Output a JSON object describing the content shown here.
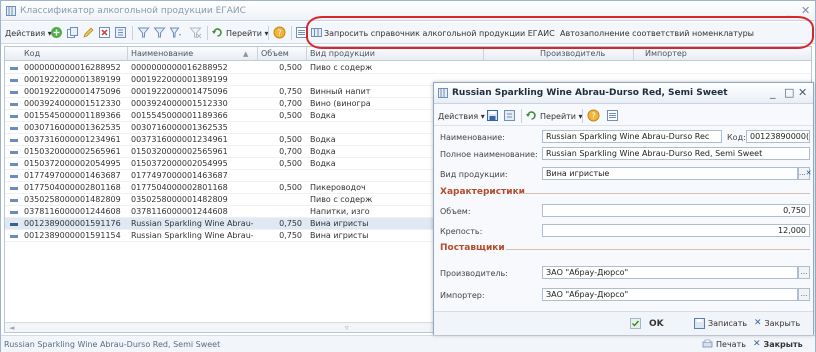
{
  "window": {
    "title": "Классификатор алкогольной продукции ЕГАИС",
    "min_glyph": "_",
    "close_glyph": "✕"
  },
  "toolbar": {
    "actions_label": "Действия ▾",
    "goto_label": "Перейти ▾",
    "request_label": "Запросить справочник алкогольной продукции ЕГАИС",
    "autofill_label": "Автозаполнение соответствий номенклатуры"
  },
  "grid": {
    "columns": [
      "Код",
      "Наименование",
      "Объем",
      "Вид продукции",
      "Производитель",
      "Импортер"
    ],
    "sort_glyph": "▲",
    "rows": [
      {
        "code": "0000000000016288952",
        "name": "0000000000016288952",
        "volume": "0,500",
        "kind": "Пиво с содерж"
      },
      {
        "code": "0001922000001389199",
        "name": "0001922000001389199",
        "volume": "",
        "kind": ""
      },
      {
        "code": "0001922000001475096",
        "name": "0001922000001475096",
        "volume": "0,750",
        "kind": "Винный напит"
      },
      {
        "code": "0003924000001512330",
        "name": "0003924000001512330",
        "volume": "0,700",
        "kind": "Вино (виногра"
      },
      {
        "code": "0015545000001189366",
        "name": "0015545000001189366",
        "volume": "0,500",
        "kind": "Водка"
      },
      {
        "code": "0030716000001362535",
        "name": "0030716000001362535",
        "volume": "",
        "kind": ""
      },
      {
        "code": "0037316000001234961",
        "name": "0037316000001234961",
        "volume": "0,500",
        "kind": "Водка"
      },
      {
        "code": "0150320000002565961",
        "name": "0150320000002565961",
        "volume": "0,700",
        "kind": "Водка"
      },
      {
        "code": "0150372000002054995",
        "name": "0150372000002054995",
        "volume": "0,500",
        "kind": "Водка"
      },
      {
        "code": "0177497000001463687",
        "name": "0177497000001463687",
        "volume": "",
        "kind": ""
      },
      {
        "code": "0177504000002801168",
        "name": "0177504000002801168",
        "volume": "0,500",
        "kind": "Пикероводоч"
      },
      {
        "code": "0350258000001482809",
        "name": "0350258000001482809",
        "volume": "",
        "kind": "Пиво с содерж"
      },
      {
        "code": "0378116000001244608",
        "name": "0378116000001244608",
        "volume": "",
        "kind": "Напитки, изго"
      },
      {
        "code": "0012389000001591176",
        "name": "Russian Sparkling Wine Abrau-Durso ...",
        "volume": "0,750",
        "kind": "Вина игристы"
      },
      {
        "code": "0012389000001591154",
        "name": "Russian Sparkling Wine Abrau-Durso,...",
        "volume": "0,750",
        "kind": "Вина игристы"
      }
    ],
    "scroll_left_glyph": "◄",
    "scroll_mid_glyph": "▿"
  },
  "status": {
    "text": "Russian Sparkling Wine Abrau-Durso Red, Semi Sweet",
    "print_label": "Печать",
    "close_label": "Закрыть"
  },
  "dialog": {
    "title": "Russian Sparkling Wine Abrau-Durso Red, Semi Sweet",
    "actions_label": "Действия ▾",
    "goto_label": "Перейти ▾",
    "name_label": "Наименование:",
    "name_value": "Russian Sparkling Wine Abrau-Durso Rec",
    "code_label": "Код:",
    "code_value": "00123890000(",
    "fullname_label": "Полное наименование:",
    "fullname_value": "Russian Sparkling Wine Abrau-Durso Red, Semi Sweet",
    "kind_label": "Вид продукции:",
    "kind_value": "Вина игристые",
    "section_characteristics": "Характеристики",
    "volume_label": "Объем:",
    "volume_value": "0,750",
    "strength_label": "Крепость:",
    "strength_value": "12,000",
    "section_suppliers": "Поставщики",
    "producer_label": "Производитель:",
    "producer_value": "ЗАО \"Абрау-Дюрсо\"",
    "importer_label": "Импортер:",
    "importer_value": "ЗАО \"Абрау-Дюрсо\"",
    "ok_label": "OK",
    "save_label": "Записать",
    "close_label": "Закрыть",
    "select_glyph": "...",
    "clear_glyph": "✕"
  }
}
